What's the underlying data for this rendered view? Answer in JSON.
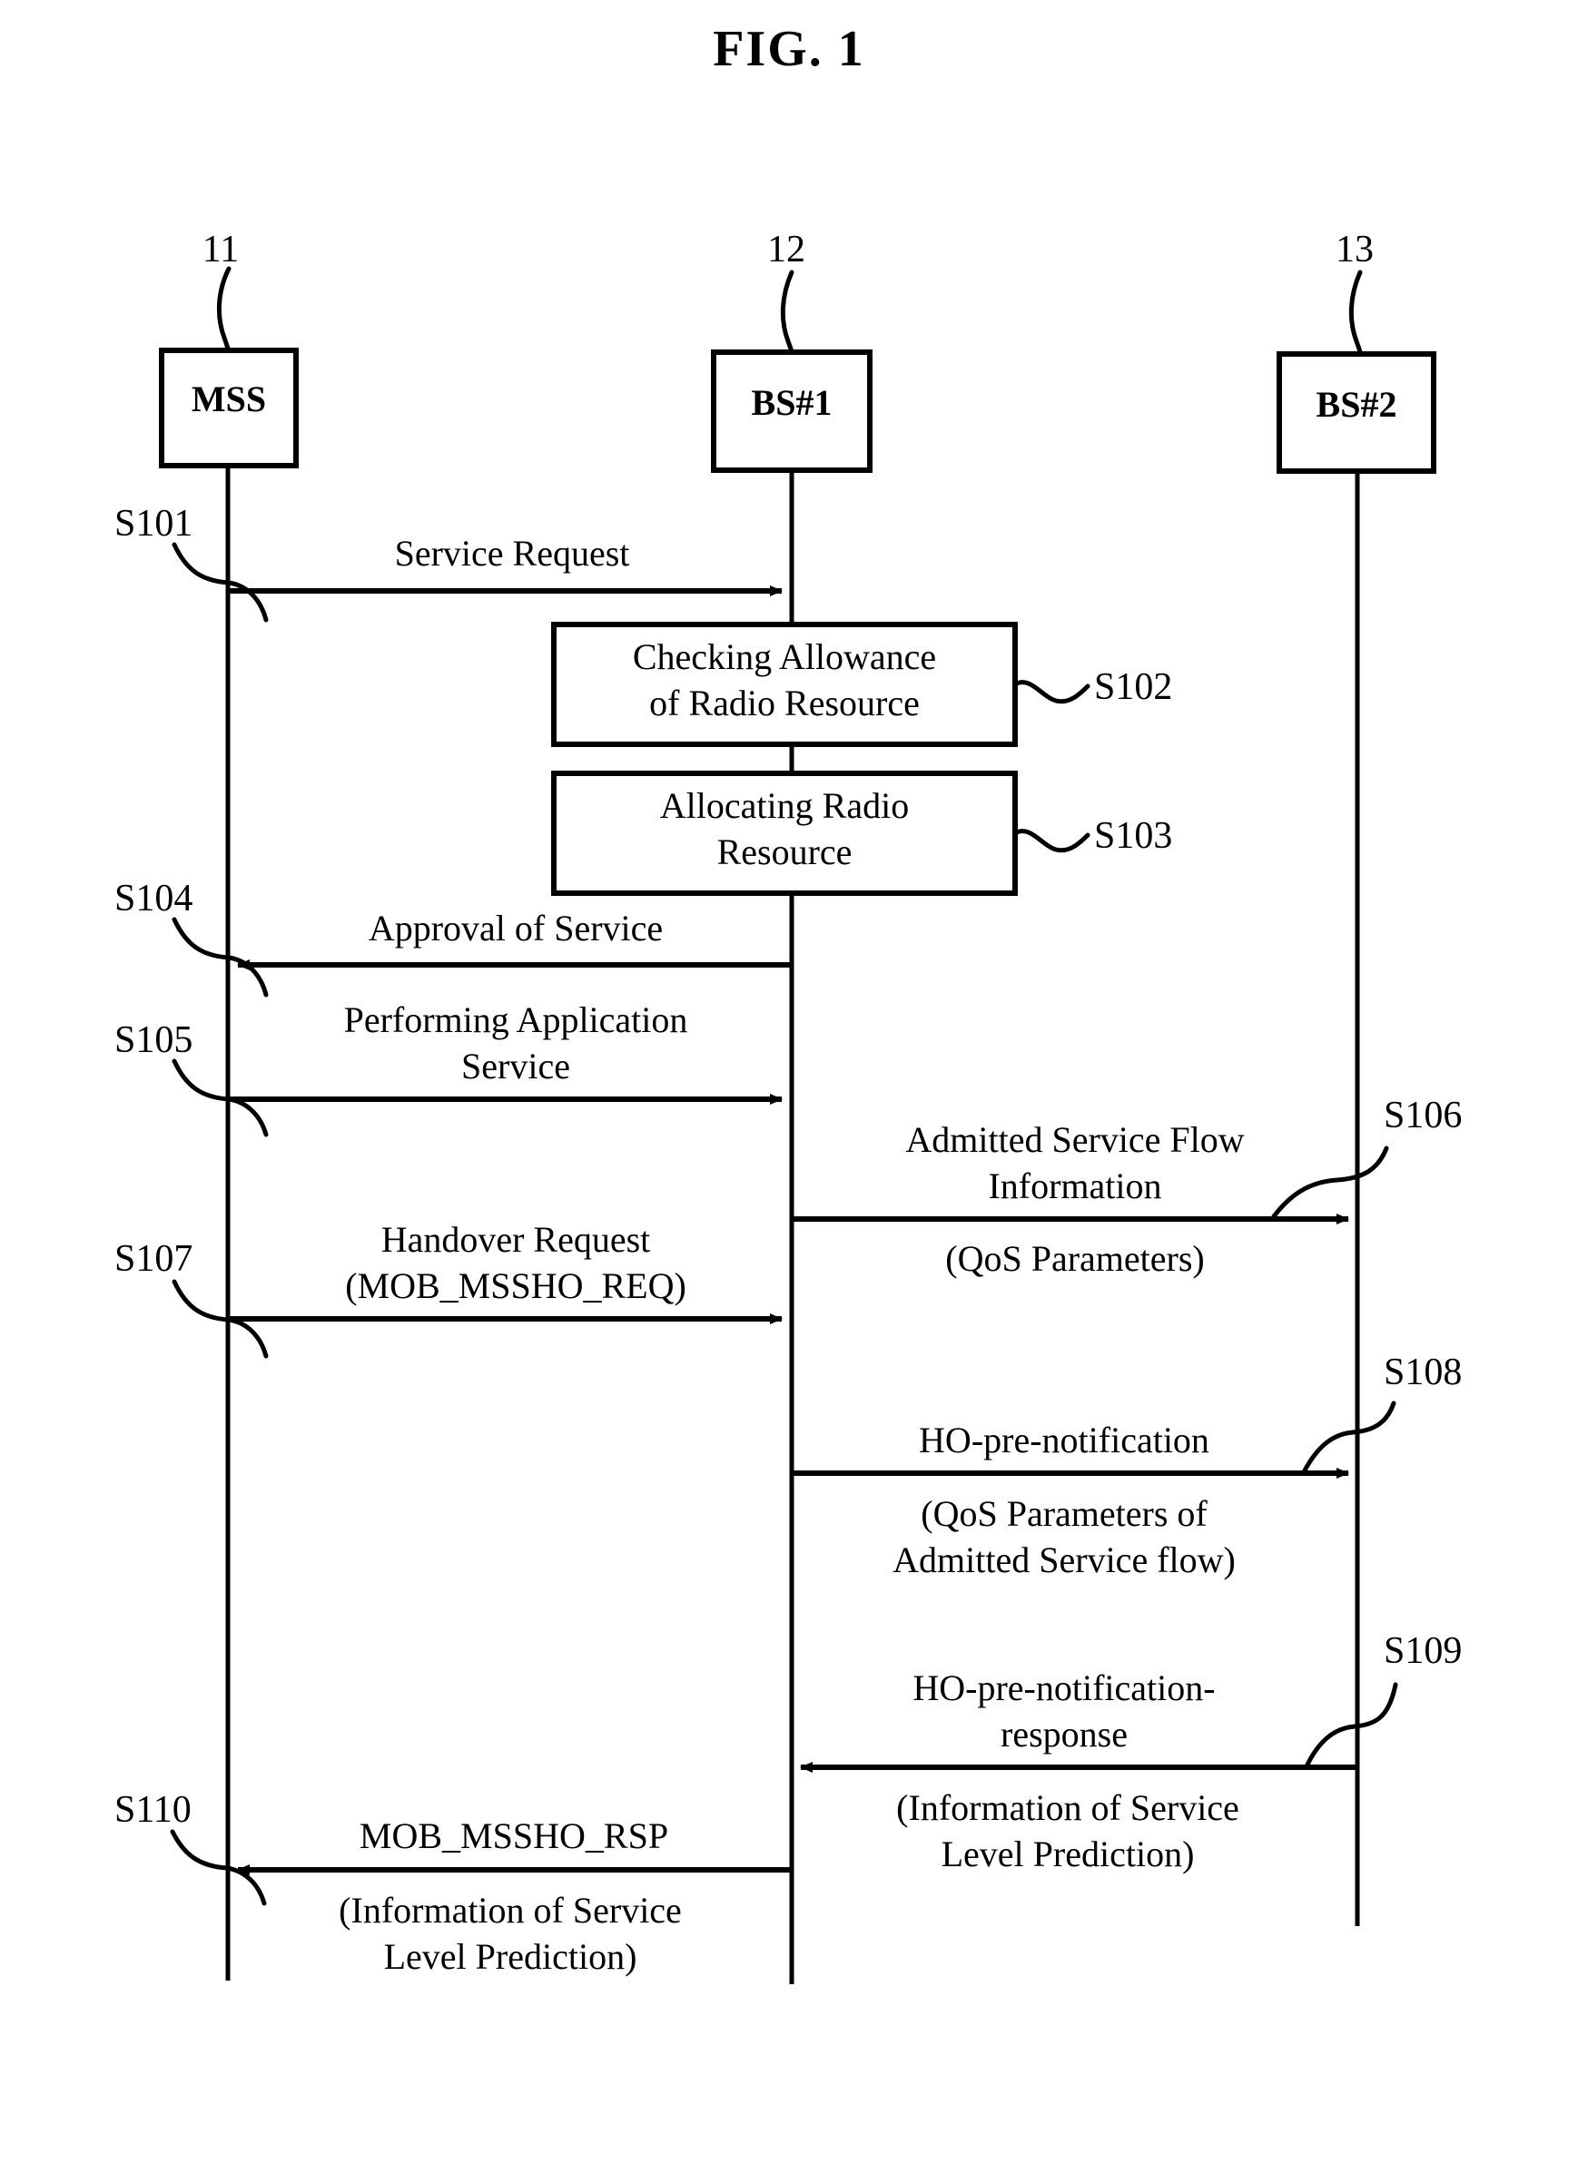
{
  "figure": {
    "title": "FIG. 1",
    "type": "sequence-diagram"
  },
  "entities": [
    {
      "ref": "11",
      "label": "MSS"
    },
    {
      "ref": "12",
      "label": "BS#1"
    },
    {
      "ref": "13",
      "label": "BS#2"
    }
  ],
  "steps": [
    {
      "id": "S101",
      "kind": "message",
      "from": "MSS",
      "to": "BS#1",
      "direction": "right",
      "lines": [
        "Service Request"
      ]
    },
    {
      "id": "S102",
      "kind": "process",
      "at": "BS#1",
      "lines": [
        "Checking Allowance",
        "of Radio Resource"
      ]
    },
    {
      "id": "S103",
      "kind": "process",
      "at": "BS#1",
      "lines": [
        "Allocating Radio",
        "Resource"
      ]
    },
    {
      "id": "S104",
      "kind": "message",
      "from": "BS#1",
      "to": "MSS",
      "direction": "left",
      "lines": [
        "Approval of Service"
      ]
    },
    {
      "id": "S105",
      "kind": "message",
      "from": "MSS",
      "to": "BS#1",
      "direction": "right",
      "lines": [
        "Performing Application",
        "Service"
      ]
    },
    {
      "id": "S106",
      "kind": "message",
      "from": "BS#1",
      "to": "BS#2",
      "direction": "right",
      "lines": [
        "Admitted Service Flow",
        "Information"
      ],
      "below": [
        "(QoS Parameters)"
      ]
    },
    {
      "id": "S107",
      "kind": "message",
      "from": "MSS",
      "to": "BS#1",
      "direction": "right",
      "lines": [
        "Handover Request",
        "(MOB_MSSHO_REQ)"
      ]
    },
    {
      "id": "S108",
      "kind": "message",
      "from": "BS#1",
      "to": "BS#2",
      "direction": "right",
      "lines": [
        "HO-pre-notification"
      ],
      "below": [
        "(QoS Parameters of",
        "Admitted Service flow)"
      ]
    },
    {
      "id": "S109",
      "kind": "message",
      "from": "BS#2",
      "to": "BS#1",
      "direction": "left",
      "lines": [
        "HO-pre-notification-",
        "response"
      ],
      "below": [
        "(Information of Service",
        "Level Prediction)"
      ]
    },
    {
      "id": "S110",
      "kind": "message",
      "from": "BS#1",
      "to": "MSS",
      "direction": "left",
      "lines": [
        "MOB_MSSHO_RSP"
      ],
      "below": [
        "(Information of Service",
        "Level Prediction)"
      ]
    }
  ],
  "labels": {
    "mss": "MSS",
    "bs1": "BS#1",
    "bs2": "BS#2",
    "ref11": "11",
    "ref12": "12",
    "ref13": "13",
    "s101": "S101",
    "s102": "S102",
    "s103": "S103",
    "s104": "S104",
    "s105": "S105",
    "s106": "S106",
    "s107": "S107",
    "s108": "S108",
    "s109": "S109",
    "s110": "S110",
    "m_service_request": "Service Request",
    "p_check_1": "Checking Allowance",
    "p_check_2": "of Radio Resource",
    "p_alloc_1": "Allocating Radio",
    "p_alloc_2": "Resource",
    "m_approval": "Approval of Service",
    "m_perform_1": "Performing Application",
    "m_perform_2": "Service",
    "m_admitted_1": "Admitted Service Flow",
    "m_admitted_2": "Information",
    "m_qos_params": "(QoS Parameters)",
    "m_handover_1": "Handover Request",
    "m_handover_2": "(MOB_MSSHO_REQ)",
    "m_hopre": "HO-pre-notification",
    "m_hopre_sub_1": "(QoS Parameters of",
    "m_hopre_sub_2": "Admitted Service flow)",
    "m_hopre_resp_1": "HO-pre-notification-",
    "m_hopre_resp_2": "response",
    "m_slp_1": "(Information of Service",
    "m_slp_2": "Level Prediction)",
    "m_mob_rsp": "MOB_MSSHO_RSP",
    "m_slp2_1": "(Information of Service",
    "m_slp2_2": "Level Prediction)"
  }
}
